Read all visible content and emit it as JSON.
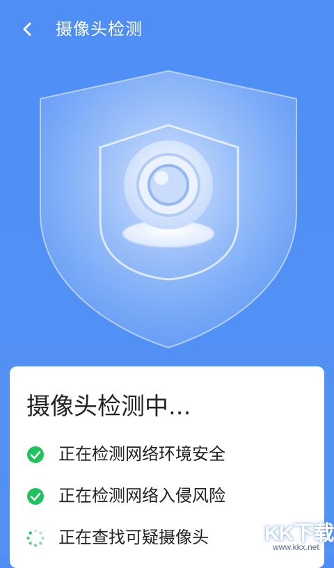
{
  "header": {
    "title": "摄像头检测",
    "back_icon": "chevron-left-icon"
  },
  "hero": {
    "icon": "shield-camera-icon"
  },
  "card": {
    "title": "摄像头检测中...",
    "items": [
      {
        "label": "正在检测网络环境安全",
        "status": "done",
        "icon": "check-circle-icon"
      },
      {
        "label": "正在检测网络入侵风险",
        "status": "done",
        "icon": "check-circle-icon"
      },
      {
        "label": "正在查找可疑摄像头",
        "status": "loading",
        "icon": "spinner-icon"
      }
    ]
  },
  "watermark": {
    "text": "KK下载",
    "url": "www.kkx.net"
  },
  "colors": {
    "background": "#4f8ff5",
    "success": "#21c15e",
    "card": "#ffffff"
  }
}
